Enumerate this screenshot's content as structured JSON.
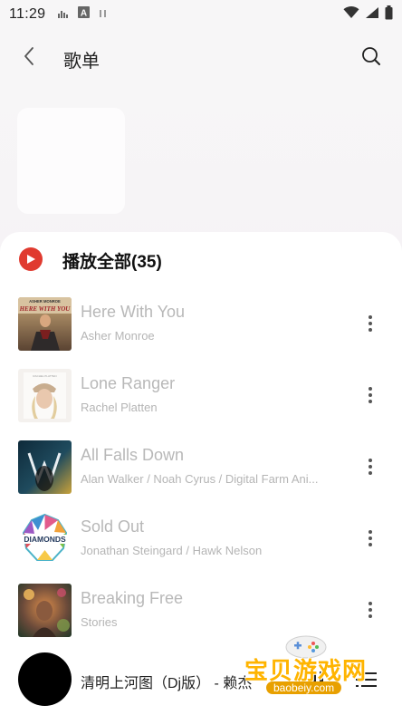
{
  "status_bar": {
    "time": "11:29",
    "icons": [
      "signal-bars-icon",
      "font-a-icon",
      "pause-bars-icon",
      "wifi-icon",
      "cell-signal-icon",
      "battery-icon"
    ]
  },
  "header": {
    "title": "歌单",
    "back_icon": "chevron-left-icon",
    "search_icon": "search-icon"
  },
  "play_all": {
    "label": "播放全部(35)",
    "icon": "play-circle-icon",
    "accent_color": "#e03a2f"
  },
  "songs": [
    {
      "title": "Here With You",
      "artist": "Asher Monroe",
      "cover_text": "ASHER MONROE\nHERE WITH YOU"
    },
    {
      "title": "Lone Ranger",
      "artist": "Rachel Platten",
      "cover_text": ""
    },
    {
      "title": "All Falls Down",
      "artist": "Alan Walker / Noah Cyrus / Digital Farm Ani...",
      "cover_text": ""
    },
    {
      "title": "Sold Out",
      "artist": "Jonathan Steingard / Hawk Nelson",
      "cover_text": "DIAMONDS"
    },
    {
      "title": "Breaking Free",
      "artist": "Stories",
      "cover_text": ""
    }
  ],
  "mini_player": {
    "title": "清明上河图（Dj版） - 赖杰",
    "pause_icon": "pause-icon",
    "playlist_icon": "playlist-icon"
  },
  "watermark": {
    "text": "宝贝游戏网",
    "sub": "baobeiy.com"
  }
}
